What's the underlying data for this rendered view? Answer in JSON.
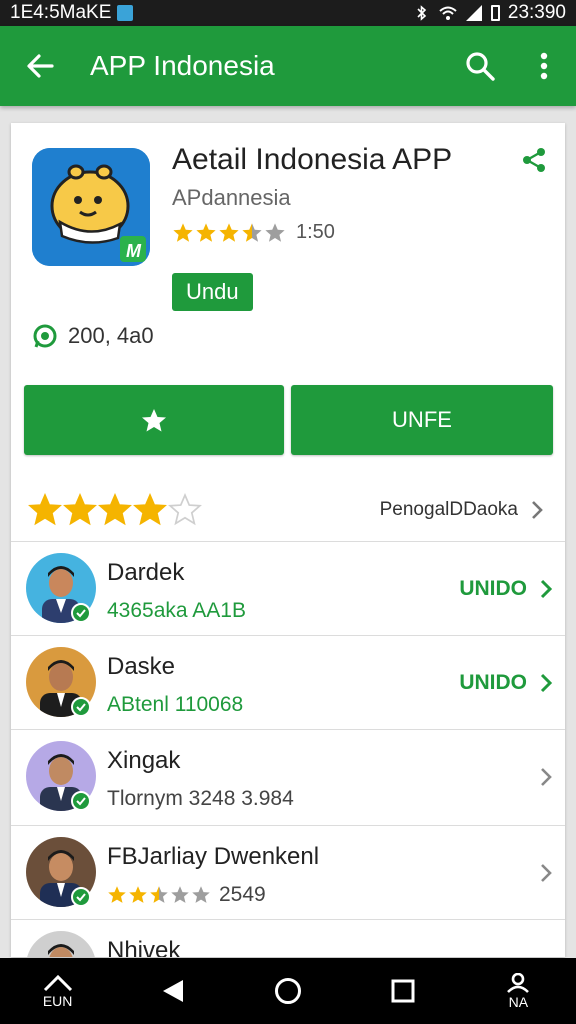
{
  "status": {
    "left_text": "1E4:5MaKE",
    "right_text": "23:390"
  },
  "appbar": {
    "title": "APP Indonesia"
  },
  "app": {
    "title": "Aetail Indonesia APP",
    "developer": "APdannesia",
    "rating_text": "1:50",
    "rating_stars": 3.5,
    "badge": "Undu",
    "downloads": "200, 4a0"
  },
  "buttons": {
    "secondary": "UNFE"
  },
  "reviews": {
    "stars": 4,
    "link_label": "PenogalDDaoka"
  },
  "list": [
    {
      "name": "Dardek",
      "sub": "4365aka AA1B",
      "sub_style": "green",
      "action": "UNIDO"
    },
    {
      "name": "Daske",
      "sub": "ABtenl 110068",
      "sub_style": "green",
      "action": "UNIDO"
    },
    {
      "name": "Xingak",
      "sub": "Tlornym 3248 3.984",
      "sub_style": "gray",
      "action": ""
    },
    {
      "name": "FBJarliay Dwenkenl",
      "sub": "2549",
      "sub_style": "gray",
      "action": "",
      "stars": 2.5
    },
    {
      "name": "Nhivek",
      "sub": "",
      "sub_style": "gray",
      "action": ""
    }
  ],
  "nav": {
    "home_label": "EUN",
    "profile_label": "NA"
  },
  "colors": {
    "accent": "#1f9a3c",
    "statusbar": "#1c1c1c",
    "star": "#f5b400"
  }
}
